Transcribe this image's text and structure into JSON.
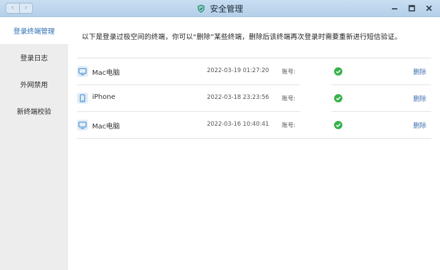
{
  "window": {
    "title": "安全管理",
    "nav_back_glyph": "‹",
    "nav_forward_glyph": "›",
    "icons": {
      "app": "shield-icon",
      "minimize": "minimize-icon",
      "maximize": "maximize-icon",
      "close": "close-icon"
    }
  },
  "sidebar": {
    "items": [
      {
        "label": "登录终端管理",
        "active": true
      },
      {
        "label": "登录日志",
        "active": false
      },
      {
        "label": "外网禁用",
        "active": false
      },
      {
        "label": "新终端校验",
        "active": false
      }
    ]
  },
  "main": {
    "notice": "以下是登录过极空间的终端，你可以“删除”某些终端，删除后该终端再次登录时需要重新进行短信验证。",
    "devices": [
      {
        "name": "Mac电脑",
        "icon": "desktop-icon",
        "time": "2022-03-19 01:27:20",
        "account_label": "账号:",
        "status_icon": "check-circle-icon",
        "delete_label": "删除"
      },
      {
        "name": "iPhone",
        "icon": "phone-icon",
        "time": "2022-03-18 23:23:56",
        "account_label": "账号:",
        "status_icon": "check-circle-icon",
        "delete_label": "删除"
      },
      {
        "name": "Mac电脑",
        "icon": "desktop-icon",
        "time": "2022-03-16 10:40:41",
        "account_label": "账号:",
        "status_icon": "check-circle-icon",
        "delete_label": "删除"
      }
    ]
  },
  "colors": {
    "titlebar": "#b4cfe9",
    "accent": "#2c6fb7",
    "success": "#36b24a",
    "link": "#3f6fb0",
    "sidebar_bg": "#ededed"
  }
}
